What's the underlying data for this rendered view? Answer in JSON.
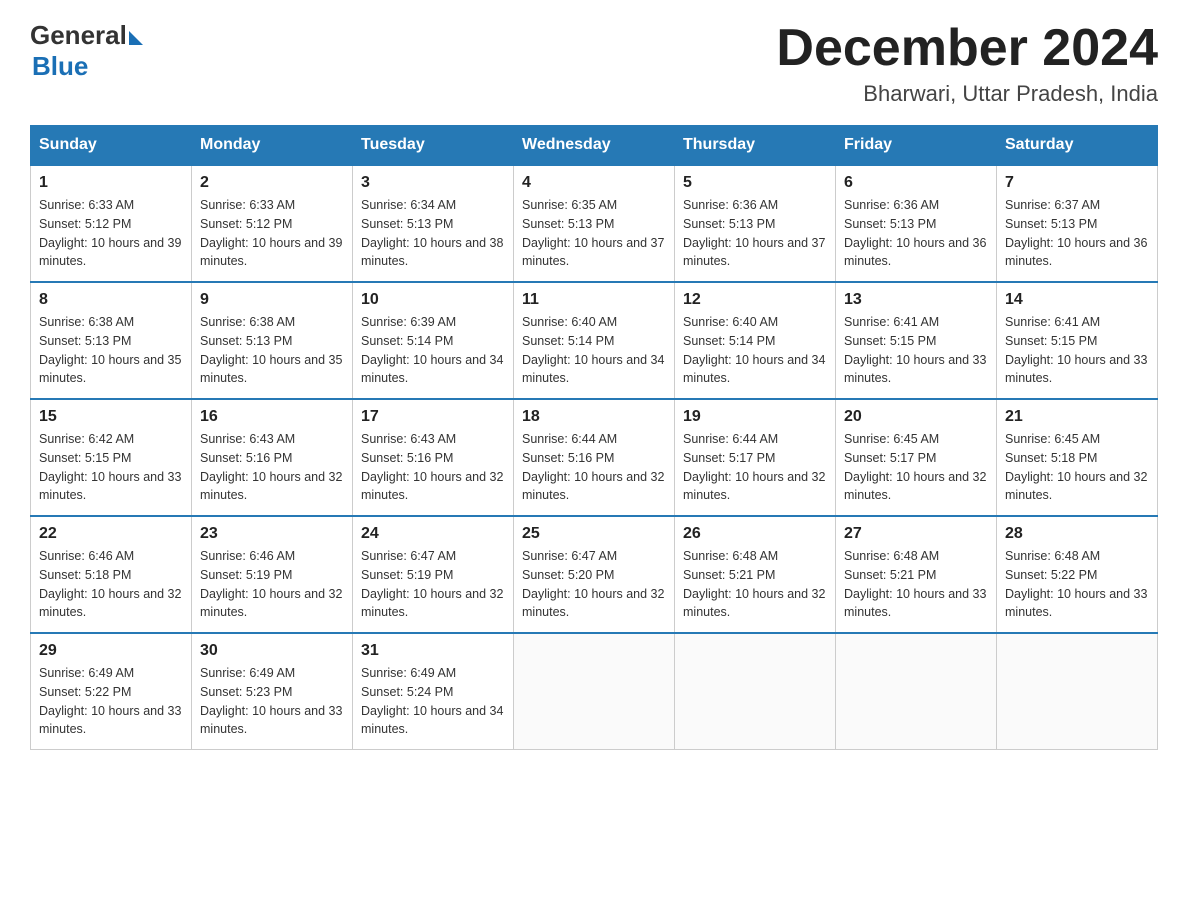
{
  "header": {
    "logo_general": "General",
    "logo_blue": "Blue",
    "month_title": "December 2024",
    "location": "Bharwari, Uttar Pradesh, India"
  },
  "weekdays": [
    "Sunday",
    "Monday",
    "Tuesday",
    "Wednesday",
    "Thursday",
    "Friday",
    "Saturday"
  ],
  "weeks": [
    [
      {
        "day": "1",
        "sunrise": "6:33 AM",
        "sunset": "5:12 PM",
        "daylight": "10 hours and 39 minutes."
      },
      {
        "day": "2",
        "sunrise": "6:33 AM",
        "sunset": "5:12 PM",
        "daylight": "10 hours and 39 minutes."
      },
      {
        "day": "3",
        "sunrise": "6:34 AM",
        "sunset": "5:13 PM",
        "daylight": "10 hours and 38 minutes."
      },
      {
        "day": "4",
        "sunrise": "6:35 AM",
        "sunset": "5:13 PM",
        "daylight": "10 hours and 37 minutes."
      },
      {
        "day": "5",
        "sunrise": "6:36 AM",
        "sunset": "5:13 PM",
        "daylight": "10 hours and 37 minutes."
      },
      {
        "day": "6",
        "sunrise": "6:36 AM",
        "sunset": "5:13 PM",
        "daylight": "10 hours and 36 minutes."
      },
      {
        "day": "7",
        "sunrise": "6:37 AM",
        "sunset": "5:13 PM",
        "daylight": "10 hours and 36 minutes."
      }
    ],
    [
      {
        "day": "8",
        "sunrise": "6:38 AM",
        "sunset": "5:13 PM",
        "daylight": "10 hours and 35 minutes."
      },
      {
        "day": "9",
        "sunrise": "6:38 AM",
        "sunset": "5:13 PM",
        "daylight": "10 hours and 35 minutes."
      },
      {
        "day": "10",
        "sunrise": "6:39 AM",
        "sunset": "5:14 PM",
        "daylight": "10 hours and 34 minutes."
      },
      {
        "day": "11",
        "sunrise": "6:40 AM",
        "sunset": "5:14 PM",
        "daylight": "10 hours and 34 minutes."
      },
      {
        "day": "12",
        "sunrise": "6:40 AM",
        "sunset": "5:14 PM",
        "daylight": "10 hours and 34 minutes."
      },
      {
        "day": "13",
        "sunrise": "6:41 AM",
        "sunset": "5:15 PM",
        "daylight": "10 hours and 33 minutes."
      },
      {
        "day": "14",
        "sunrise": "6:41 AM",
        "sunset": "5:15 PM",
        "daylight": "10 hours and 33 minutes."
      }
    ],
    [
      {
        "day": "15",
        "sunrise": "6:42 AM",
        "sunset": "5:15 PM",
        "daylight": "10 hours and 33 minutes."
      },
      {
        "day": "16",
        "sunrise": "6:43 AM",
        "sunset": "5:16 PM",
        "daylight": "10 hours and 32 minutes."
      },
      {
        "day": "17",
        "sunrise": "6:43 AM",
        "sunset": "5:16 PM",
        "daylight": "10 hours and 32 minutes."
      },
      {
        "day": "18",
        "sunrise": "6:44 AM",
        "sunset": "5:16 PM",
        "daylight": "10 hours and 32 minutes."
      },
      {
        "day": "19",
        "sunrise": "6:44 AM",
        "sunset": "5:17 PM",
        "daylight": "10 hours and 32 minutes."
      },
      {
        "day": "20",
        "sunrise": "6:45 AM",
        "sunset": "5:17 PM",
        "daylight": "10 hours and 32 minutes."
      },
      {
        "day": "21",
        "sunrise": "6:45 AM",
        "sunset": "5:18 PM",
        "daylight": "10 hours and 32 minutes."
      }
    ],
    [
      {
        "day": "22",
        "sunrise": "6:46 AM",
        "sunset": "5:18 PM",
        "daylight": "10 hours and 32 minutes."
      },
      {
        "day": "23",
        "sunrise": "6:46 AM",
        "sunset": "5:19 PM",
        "daylight": "10 hours and 32 minutes."
      },
      {
        "day": "24",
        "sunrise": "6:47 AM",
        "sunset": "5:19 PM",
        "daylight": "10 hours and 32 minutes."
      },
      {
        "day": "25",
        "sunrise": "6:47 AM",
        "sunset": "5:20 PM",
        "daylight": "10 hours and 32 minutes."
      },
      {
        "day": "26",
        "sunrise": "6:48 AM",
        "sunset": "5:21 PM",
        "daylight": "10 hours and 32 minutes."
      },
      {
        "day": "27",
        "sunrise": "6:48 AM",
        "sunset": "5:21 PM",
        "daylight": "10 hours and 33 minutes."
      },
      {
        "day": "28",
        "sunrise": "6:48 AM",
        "sunset": "5:22 PM",
        "daylight": "10 hours and 33 minutes."
      }
    ],
    [
      {
        "day": "29",
        "sunrise": "6:49 AM",
        "sunset": "5:22 PM",
        "daylight": "10 hours and 33 minutes."
      },
      {
        "day": "30",
        "sunrise": "6:49 AM",
        "sunset": "5:23 PM",
        "daylight": "10 hours and 33 minutes."
      },
      {
        "day": "31",
        "sunrise": "6:49 AM",
        "sunset": "5:24 PM",
        "daylight": "10 hours and 34 minutes."
      },
      null,
      null,
      null,
      null
    ]
  ]
}
